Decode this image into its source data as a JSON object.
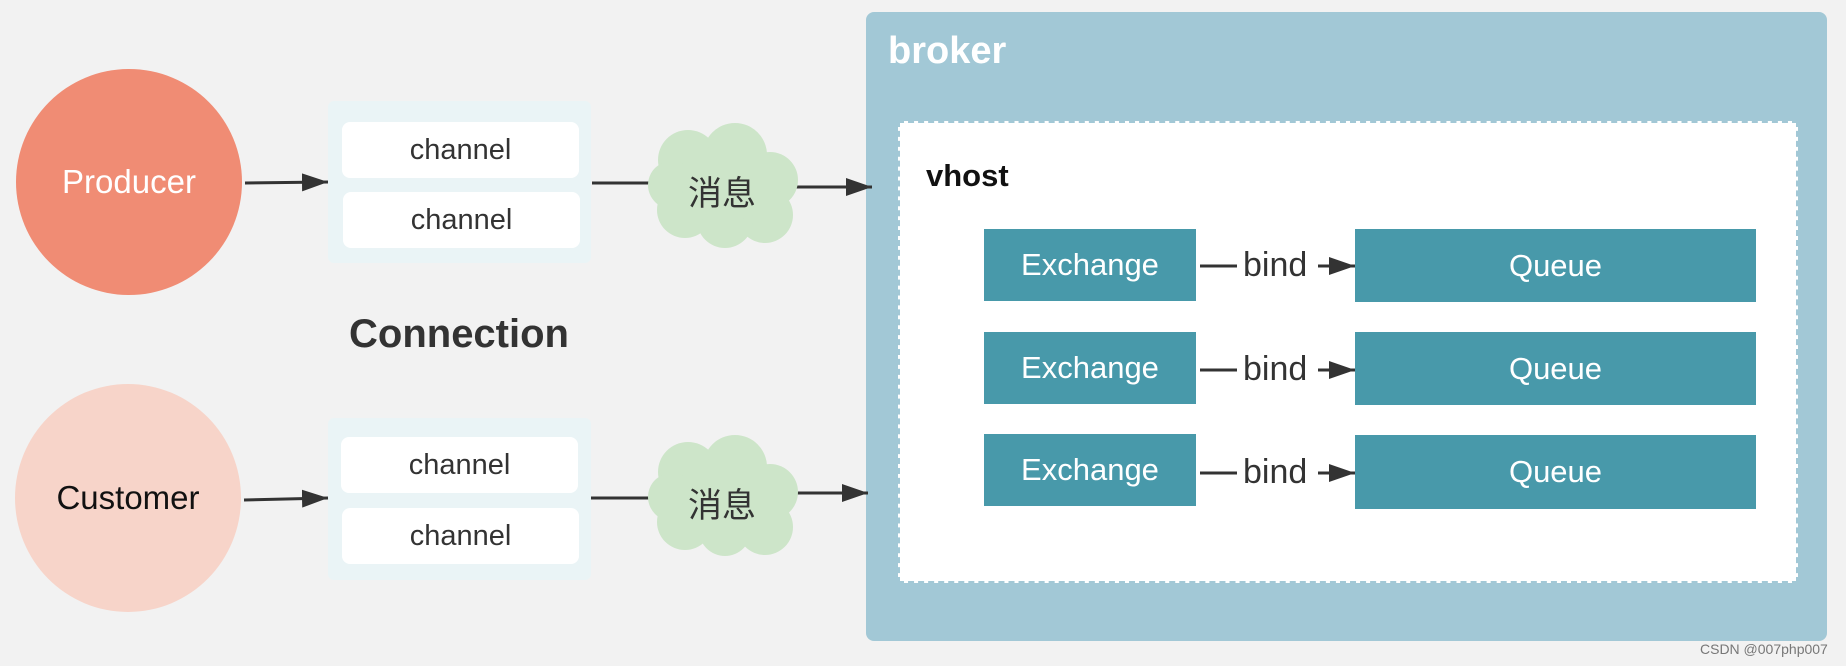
{
  "producer": {
    "label": "Producer",
    "color": "#f08c74"
  },
  "customer": {
    "label": "Customer",
    "color": "#f7d4c9"
  },
  "connection": {
    "label": "Connection",
    "channels_top": [
      "channel",
      "channel"
    ],
    "channels_bottom": [
      "channel",
      "channel"
    ]
  },
  "message": {
    "label": "消息",
    "color": "#cde5c9"
  },
  "broker": {
    "label": "broker",
    "color": "#a2c8d6",
    "vhost": {
      "label": "vhost",
      "bindings": [
        {
          "exchange": "Exchange",
          "bind": "bind",
          "queue": "Queue"
        },
        {
          "exchange": "Exchange",
          "bind": "bind",
          "queue": "Queue"
        },
        {
          "exchange": "Exchange",
          "bind": "bind",
          "queue": "Queue"
        }
      ]
    }
  },
  "watermark": "CSDN @007php007"
}
